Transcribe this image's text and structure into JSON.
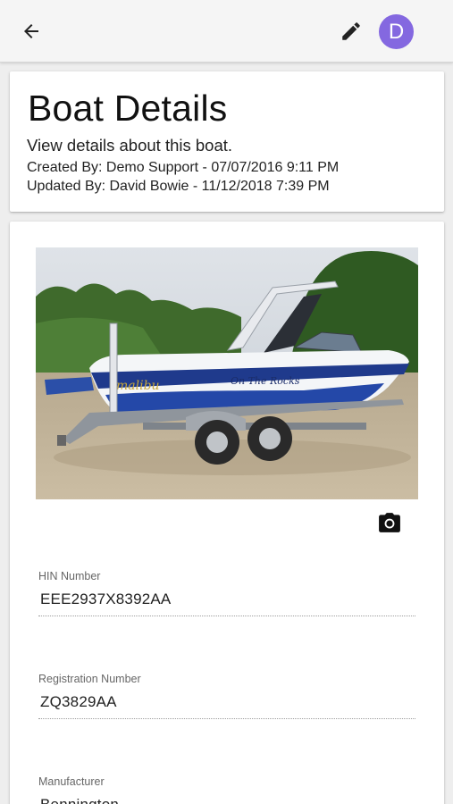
{
  "app_bar": {
    "back_icon": "arrow-left-icon",
    "edit_icon": "pencil-icon",
    "avatar_initial": "D",
    "avatar_color": "#8468e0"
  },
  "header": {
    "title": "Boat Details",
    "subtitle": "View details about this boat.",
    "created": "Created By: Demo Support - 07/07/2016 9:11 PM",
    "updated": "Updated By: David Bowie - 11/12/2018 7:39 PM"
  },
  "photo": {
    "hull_lettering": "On The Rocks",
    "camera_icon": "camera-icon"
  },
  "fields": {
    "hin": {
      "label": "HIN Number",
      "value": "EEE2937X8392AA"
    },
    "registration": {
      "label": "Registration Number",
      "value": "ZQ3829AA"
    },
    "manufacturer": {
      "label": "Manufacturer",
      "value": "Bennington"
    }
  }
}
